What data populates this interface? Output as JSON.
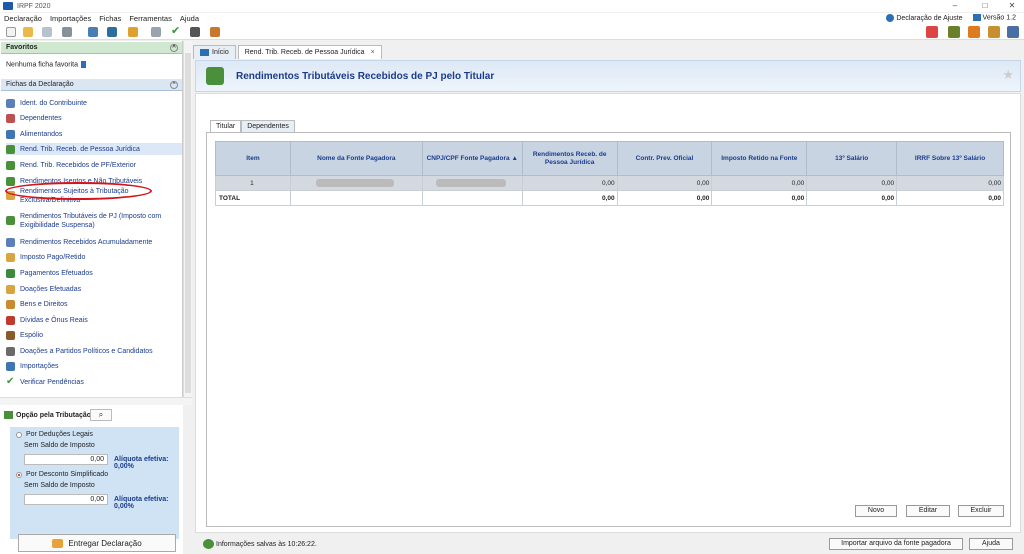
{
  "window": {
    "title": "IRPF 2020",
    "minimize": "–",
    "maximize": "□",
    "close": "✕"
  },
  "menu": {
    "items": [
      "Declaração",
      "Importações",
      "Fichas",
      "Ferramentas",
      "Ajuda"
    ],
    "declaracao_ajuste": "Declaração de Ajuste",
    "versao": "Versão 1.2"
  },
  "favorites": {
    "header": "Favoritos",
    "empty": "Nenhuma ficha favorita"
  },
  "fichas": {
    "header": "Fichas da Declaração",
    "items": [
      {
        "label": "Ident. do Contribuinte",
        "color": "#5b7fb8"
      },
      {
        "label": "Dependentes",
        "color": "#c0504d"
      },
      {
        "label": "Alimentandos",
        "color": "#3f75b3"
      },
      {
        "label": "Rend. Trib. Receb. de Pessoa Jurídica",
        "color": "#4a8f3a"
      },
      {
        "label": "Rend. Trib. Recebidos de PF/Exterior",
        "color": "#4a8f3a"
      },
      {
        "label": "Rendimentos Isentos e Não Tributáveis",
        "color": "#4a8f3a"
      },
      {
        "label": "Rendimentos Sujeitos à Tributação Exclusiva/Definitiva",
        "color": "#d9a441"
      },
      {
        "label": "Rendimentos Tributáveis de PJ (Imposto com Exigibilidade Suspensa)",
        "color": "#4a8f3a"
      },
      {
        "label": "Rendimentos Recebidos Acumuladamente",
        "color": "#5b7fb8"
      },
      {
        "label": "Imposto Pago/Retido",
        "color": "#d9a441"
      },
      {
        "label": "Pagamentos Efetuados",
        "color": "#3c8a3c"
      },
      {
        "label": "Doações Efetuadas",
        "color": "#d9a441"
      },
      {
        "label": "Bens e Direitos",
        "color": "#c98b2e"
      },
      {
        "label": "Dívidas e Ônus Reais",
        "color": "#c0392b"
      },
      {
        "label": "Espólio",
        "color": "#8a5a2b"
      },
      {
        "label": "Doações a Partidos Políticos e Candidatos",
        "color": "#6a6a6a"
      },
      {
        "label": "Importações",
        "color": "#3f75b3"
      },
      {
        "label": "Verificar Pendências",
        "color": "#3c9a3c"
      }
    ]
  },
  "opcao": {
    "header": "Opção pela Tributação:",
    "deducoes_label": "Por Deduções Legais",
    "saldo1": "Sem Saldo de Imposto",
    "valor1": "0,00",
    "aliq1": "Alíquota efetiva: 0,00%",
    "simplificado_label": "Por Desconto Simplificado",
    "saldo2": "Sem Saldo de Imposto",
    "valor2": "0,00",
    "aliq2": "Alíquota efetiva: 0,00%",
    "entregar": "Entregar Declaração"
  },
  "tabs": {
    "inicio": "Início",
    "current": "Rend. Trib. Receb. de Pessoa Jurídica",
    "close": "×"
  },
  "panel": {
    "title": "Rendimentos Tributáveis Recebidos de PJ pelo Titular"
  },
  "subtabs": {
    "titular": "Titular",
    "dependentes": "Dependentes"
  },
  "table": {
    "headers": [
      "Item",
      "Nome da Fonte Pagadora",
      "CNPJ/CPF Fonte Pagadora",
      "Rendimentos Receb. de Pessoa Jurídica",
      "Contr. Prev. Oficial",
      "Imposto Retido na Fonte",
      "13º Salário",
      "IRRF Sobre 13º Salário"
    ],
    "sort_arrow": "▲",
    "rows": [
      {
        "item": "1",
        "rend": "0,00",
        "prev": "0,00",
        "imposto": "0,00",
        "sal13": "0,00",
        "irrf13": "0,00"
      }
    ],
    "total": {
      "label": "TOTAL",
      "rend": "0,00",
      "prev": "0,00",
      "imposto": "0,00",
      "sal13": "0,00",
      "irrf13": "0,00"
    }
  },
  "buttons": {
    "novo": "Novo",
    "editar": "Editar",
    "excluir": "Excluir",
    "importar": "Importar arquivo da fonte pagadora",
    "ajuda": "Ajuda"
  },
  "status": {
    "text": "Informações salvas às 10:26:22."
  }
}
